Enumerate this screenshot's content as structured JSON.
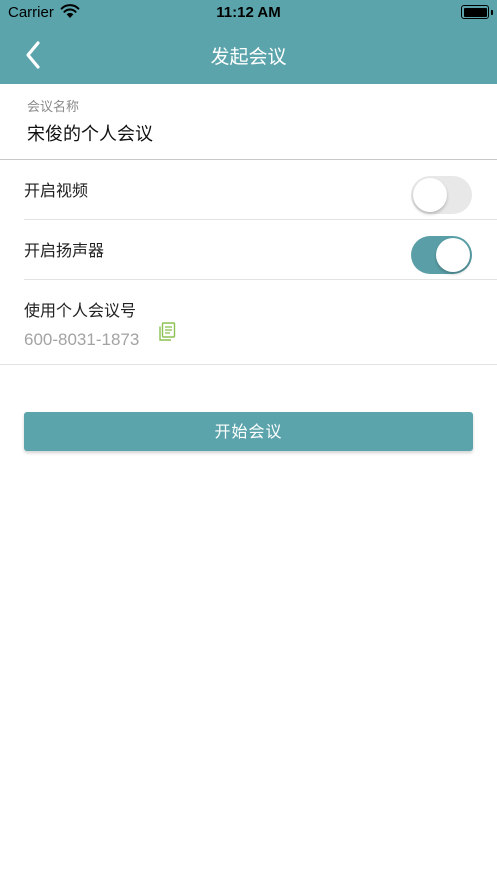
{
  "status_bar": {
    "carrier": "Carrier",
    "time": "11:12 AM",
    "battery_level": 1.0,
    "wifi_icon": "wifi-icon",
    "battery_icon": "battery-icon"
  },
  "nav": {
    "title": "发起会议",
    "back_icon": "chevron-left-icon",
    "background": "#5ba4ac"
  },
  "meeting_name": {
    "label": "会议名称",
    "value": "宋俊的个人会议"
  },
  "settings": {
    "video": {
      "label": "开启视频",
      "enabled": false
    },
    "speaker": {
      "label": "开启扬声器",
      "enabled": true
    }
  },
  "personal_meeting": {
    "label": "使用个人会议号",
    "number": "600-8031-1873",
    "copy_icon": "copy-icon",
    "icon_color": "#8cc152"
  },
  "start_button": {
    "label": "开始会议",
    "color": "#5ba4ac"
  },
  "colors": {
    "accent": "#5ba4ac",
    "switch_on": "#5a9fa7",
    "switch_off": "#e8e8e8"
  }
}
